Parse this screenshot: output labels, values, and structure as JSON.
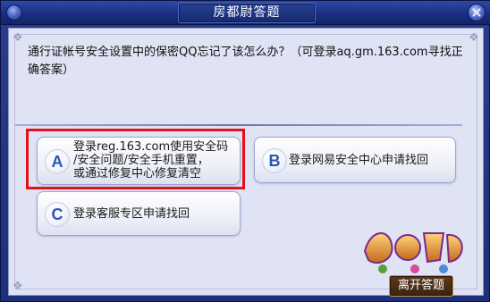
{
  "window": {
    "title": "房都尉答题"
  },
  "question": {
    "text": "通行证帐号安全设置中的保密QQ忘记了该怎么办？（可登录aq.gm.163.com寻找正确答案）"
  },
  "options": [
    {
      "letter": "A",
      "lines": [
        "登录reg.163.com使用安全码",
        "/安全问题/安全手机重置，",
        "或通过修复中心修复清空"
      ],
      "highlighted": true
    },
    {
      "letter": "B",
      "lines": [
        "登录网易安全中心申请找回"
      ],
      "highlighted": false
    },
    {
      "letter": "C",
      "lines": [
        "登录客服专区申请找回"
      ],
      "highlighted": false
    }
  ],
  "footer": {
    "leave_label": "离开答题"
  },
  "colors": {
    "highlight": "#e5101c",
    "badge_letter": "#2a56b5"
  },
  "icons": {
    "close": "close-icon"
  }
}
